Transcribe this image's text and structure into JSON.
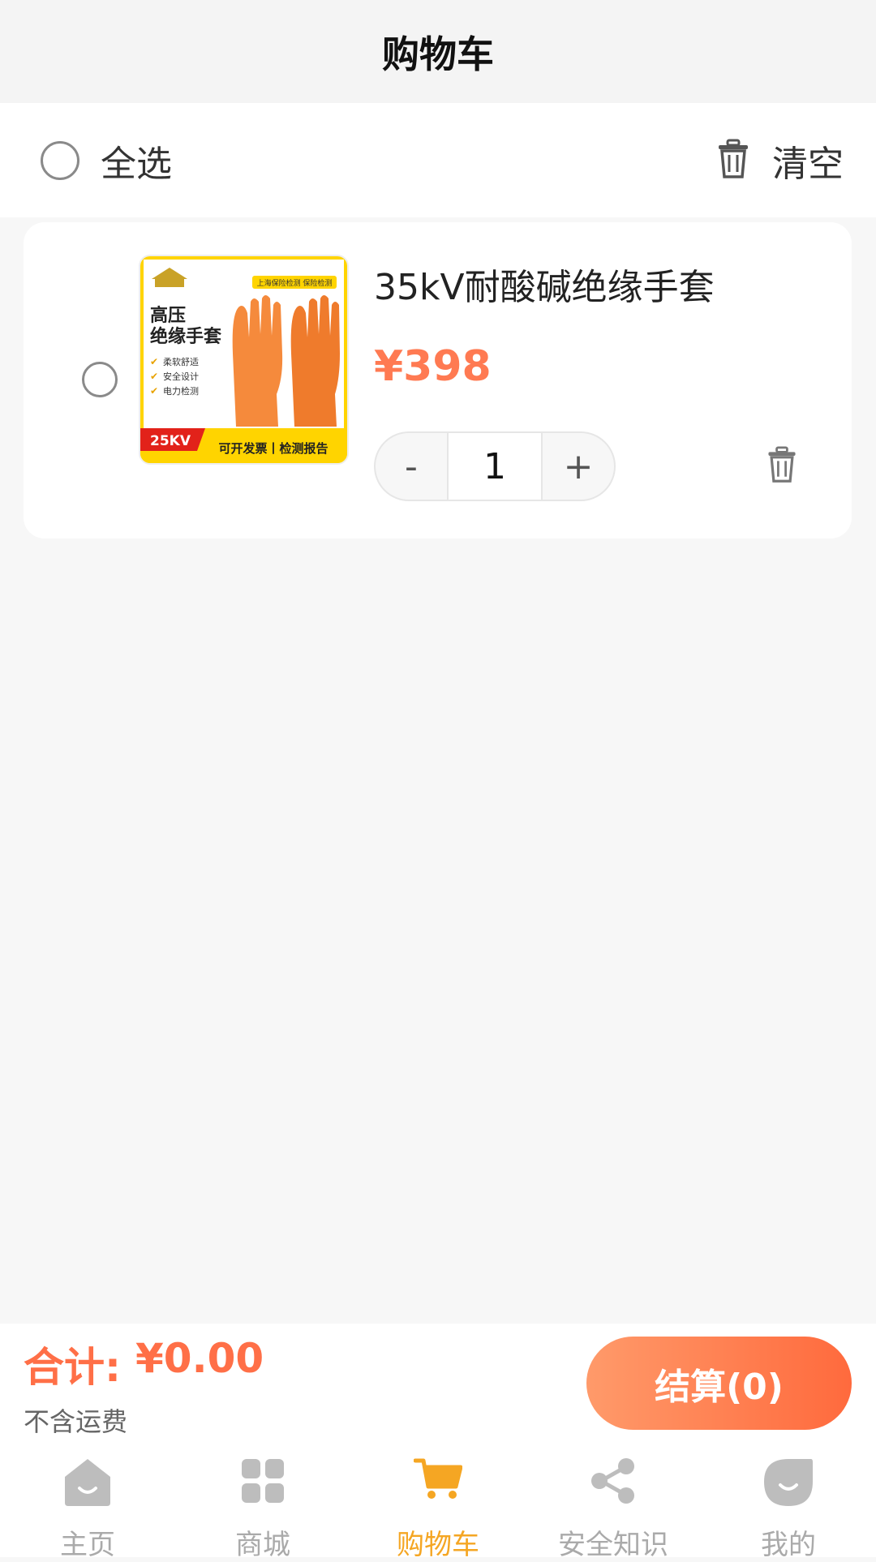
{
  "header": {
    "title": "购物车"
  },
  "select_bar": {
    "select_all_label": "全选",
    "clear_label": "清空"
  },
  "cart_items": [
    {
      "name": "35kV耐酸碱绝缘手套",
      "price": "¥398",
      "quantity": "1",
      "minus_label": "-",
      "plus_label": "+",
      "thumbnail": {
        "top_badge": "上海保险检测 保险检测",
        "headline_1": "高压",
        "headline_2": "绝缘手套",
        "features": [
          "柔软舒适",
          "安全设计",
          "电力检测"
        ],
        "voltage_badge": "25KV",
        "footer_text": "可开发票丨检测报告"
      }
    }
  ],
  "checkout": {
    "total_label": "合计:",
    "total_value": "¥0.00",
    "shipping_note": "不含运费",
    "checkout_label": "结算(0)"
  },
  "tabbar": {
    "tabs": [
      {
        "label": "主页",
        "icon": "home-icon",
        "active": false
      },
      {
        "label": "商城",
        "icon": "grid-icon",
        "active": false
      },
      {
        "label": "购物车",
        "icon": "cart-icon",
        "active": true
      },
      {
        "label": "安全知识",
        "icon": "share-icon",
        "active": false
      },
      {
        "label": "我的",
        "icon": "profile-icon",
        "active": false
      }
    ]
  },
  "colors": {
    "accent": "#ff7a52",
    "tab_active": "#f5a623",
    "tab_inactive": "#aaaaaa",
    "glove_orange": "#f58a3c",
    "thumb_yellow": "#ffd400"
  }
}
